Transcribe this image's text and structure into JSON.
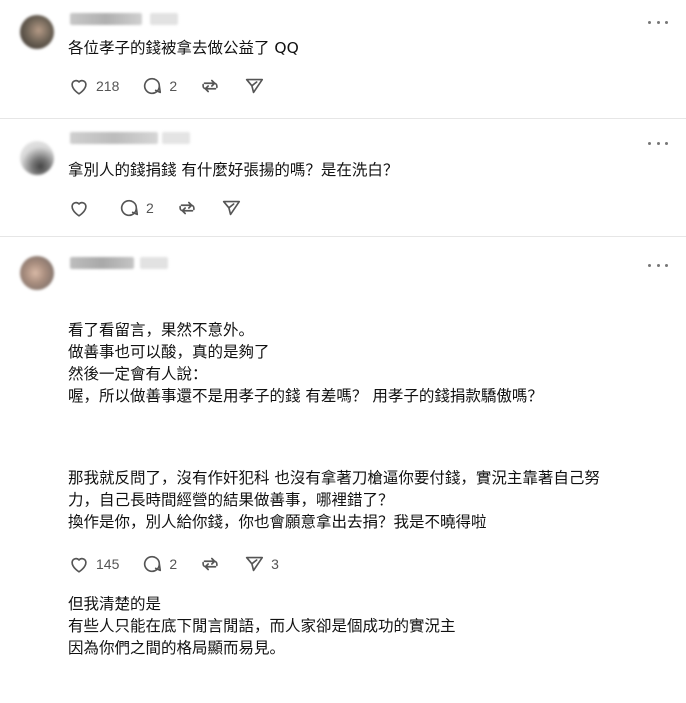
{
  "posts": [
    {
      "text": "各位孝子的錢被拿去做公益了 QQ",
      "likes": "218",
      "replies": "2",
      "reposts": "",
      "shares": ""
    },
    {
      "text": "拿別人的錢捐錢 有什麼好張揚的嗎？是在洗白？",
      "likes": "",
      "replies": "2",
      "reposts": "",
      "shares": ""
    },
    {
      "paragraphs": [
        "看了看留言，果然不意外。\n做善事也可以酸，真的是夠了\n然後一定會有人說：\n喔，所以做善事還不是用孝子的錢 有差嗎？ 用孝子的錢捐款驕傲嗎？",
        "那我就反問了，沒有作奸犯科 也沒有拿著刀槍逼你要付錢，實況主靠著自己努\n力，自己長時間經營的結果做善事，哪裡錯了？\n換作是你，別人給你錢，你也會願意拿出去捐？我是不曉得啦",
        "但我清楚的是\n有些人只能在底下閒言閒語，而人家卻是個成功的實況主\n因為你們之間的格局顯而易見。"
      ],
      "likes": "145",
      "replies": "2",
      "reposts": "",
      "shares": "3"
    }
  ],
  "icons": {
    "like": "heart-icon",
    "reply": "comment-icon",
    "repost": "repost-icon",
    "share": "send-icon",
    "more": "more-horizontal-icon"
  },
  "colors": {
    "text": "#111111",
    "icon": "#555555",
    "divider": "#e6e6e6",
    "background": "#ffffff"
  }
}
